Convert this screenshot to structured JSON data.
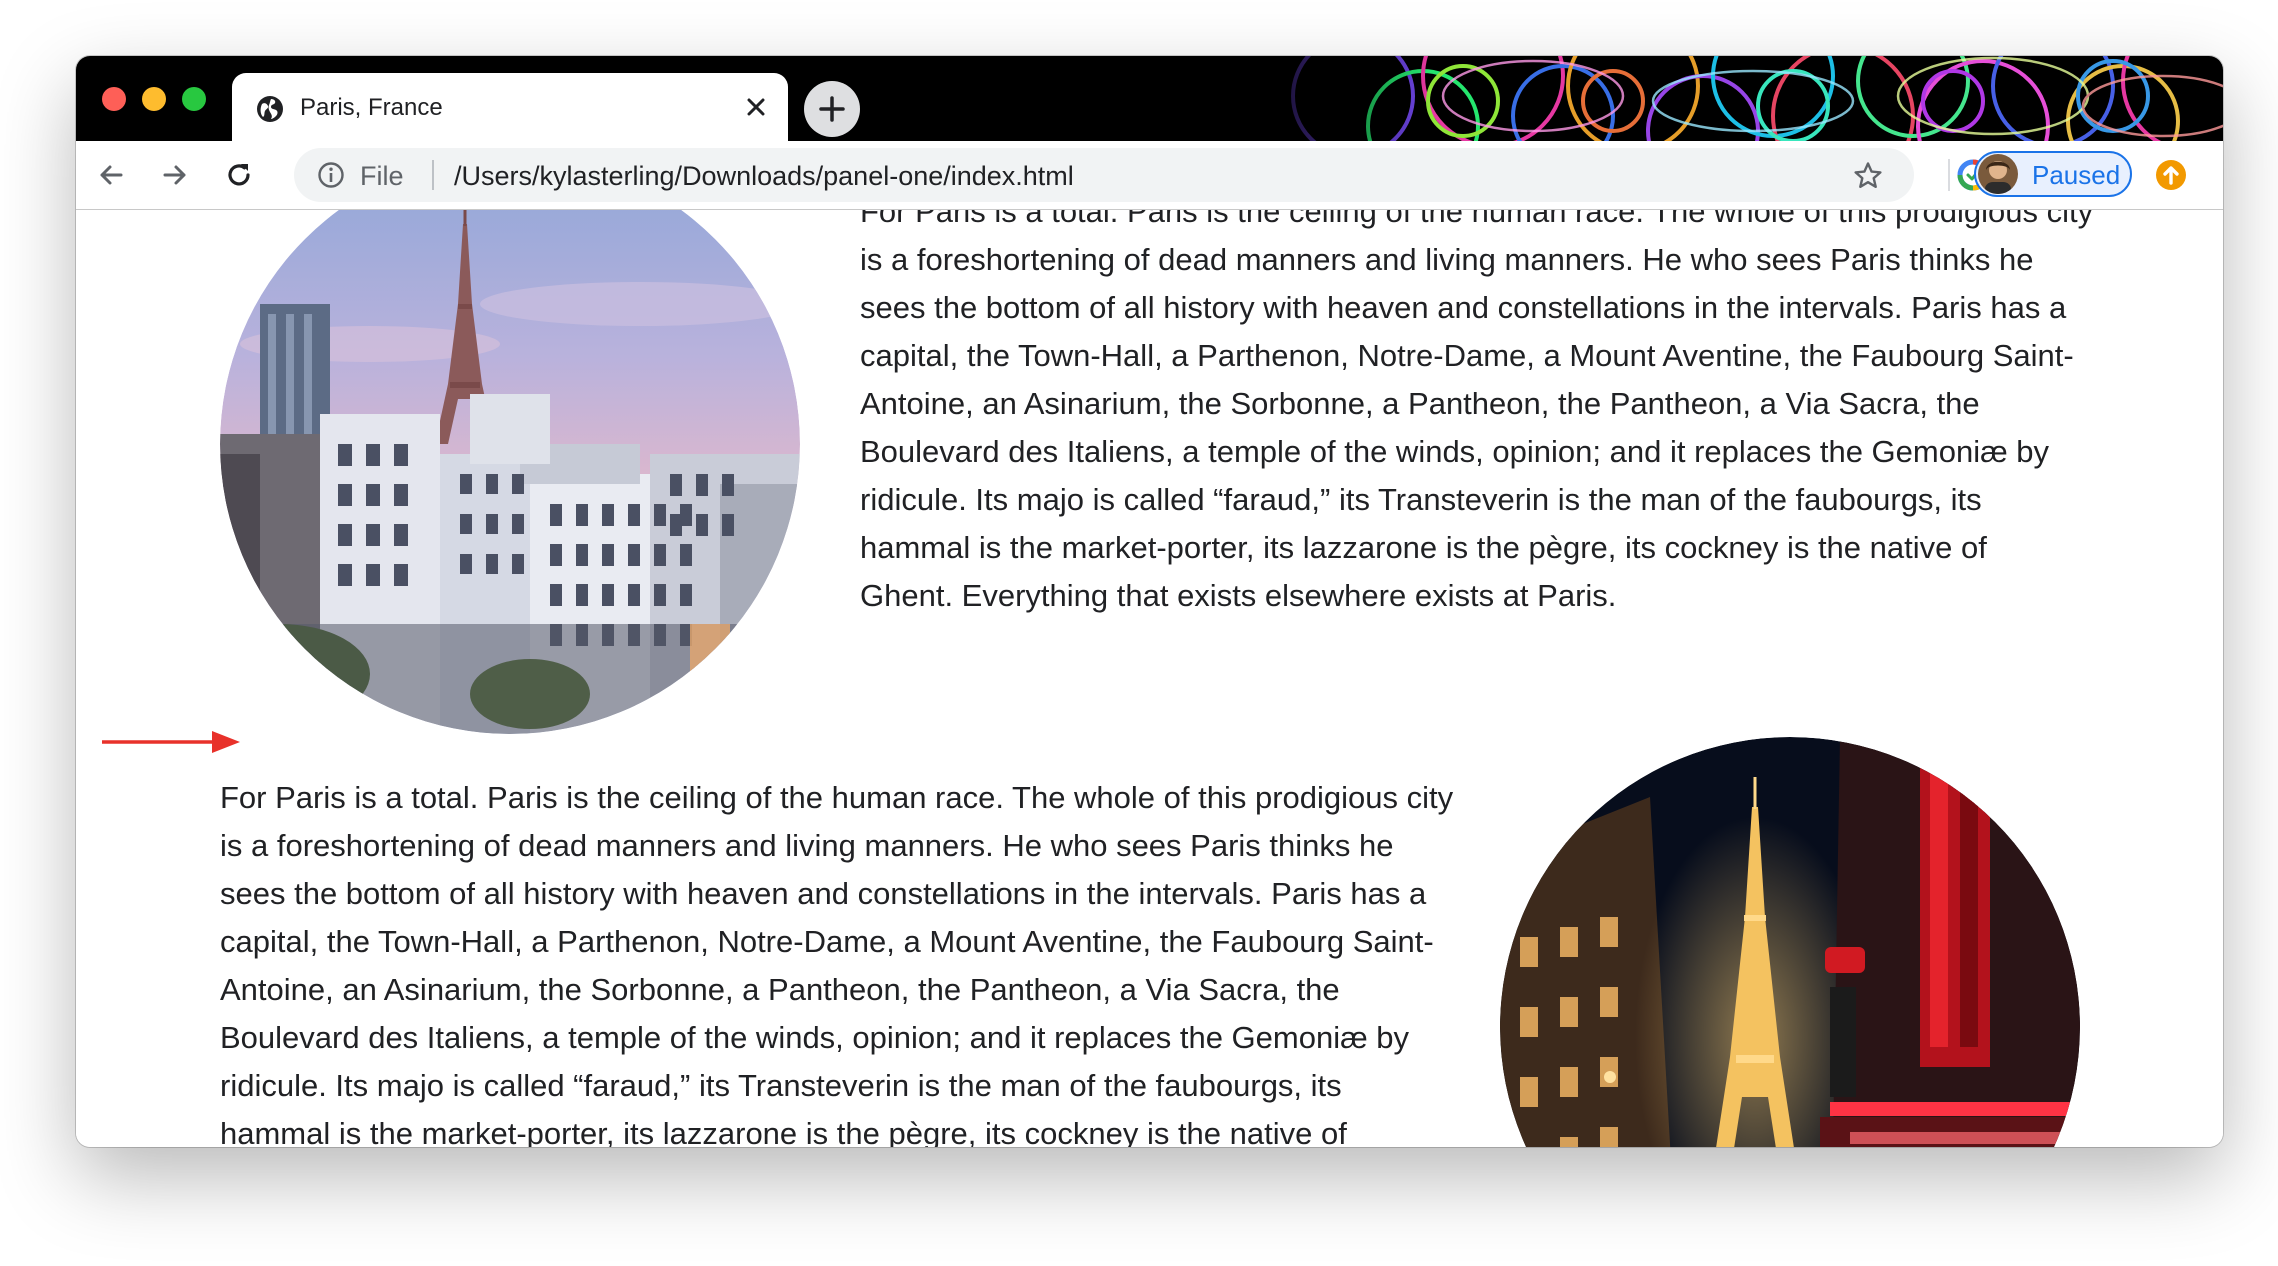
{
  "browser": {
    "tab": {
      "title": "Paris, France",
      "favicon": "globe-icon"
    },
    "toolbar": {
      "scheme_label": "File",
      "url": "/Users/kylasterling/Downloads/panel-one/index.html",
      "profile_status": "Paused"
    },
    "colors": {
      "accent": "#1a73e8",
      "traffic_red": "#fe5f57",
      "traffic_yellow": "#febc2e",
      "traffic_green": "#28c840",
      "annotation_arrow": "#e8312a",
      "update_badge": "#f29900"
    }
  },
  "page": {
    "sections": [
      {
        "image": "paris-daytime-eiffel-photo",
        "text_lines": [
          "For Paris is a total. Paris is the ceiling of the human race. The whole of this prodigious city",
          "is a foreshortening of dead manners and living manners. He who sees Paris thinks he",
          "sees the bottom of all history with heaven and constellations in the intervals. Paris has a",
          "capital, the Town-Hall, a Parthenon, Notre-Dame, a Mount Aventine, the Faubourg Saint-",
          "Antoine, an Asinarium, the Sorbonne, a Pantheon, the Pantheon, a Via Sacra, the",
          "Boulevard des Italiens, a temple of the winds, opinion; and it replaces the Gemoniæ by",
          "ridicule. Its majo is called “faraud,” its Transteverin is the man of the faubourgs, its",
          "hammal is the market-porter, its lazzarone is the pègre, its cockney is the native of",
          "Ghent. Everything that exists elsewhere exists at Paris."
        ]
      },
      {
        "image": "paris-night-eiffel-photo",
        "text_lines": [
          "For Paris is a total. Paris is the ceiling of the human race. The whole of this prodigious city",
          "is a foreshortening of dead manners and living manners. He who sees Paris thinks he",
          "sees the bottom of all history with heaven and constellations in the intervals. Paris has a",
          "capital, the Town-Hall, a Parthenon, Notre-Dame, a Mount Aventine, the Faubourg Saint-",
          "Antoine, an Asinarium, the Sorbonne, a Pantheon, the Pantheon, a Via Sacra, the",
          "Boulevard des Italiens, a temple of the winds, opinion; and it replaces the Gemoniæ by",
          "ridicule. Its majo is called “faraud,” its Transteverin is the man of the faubourgs, its",
          "hammal is the market-porter, its lazzarone is the pègre, its cockney is the native of"
        ]
      }
    ]
  }
}
